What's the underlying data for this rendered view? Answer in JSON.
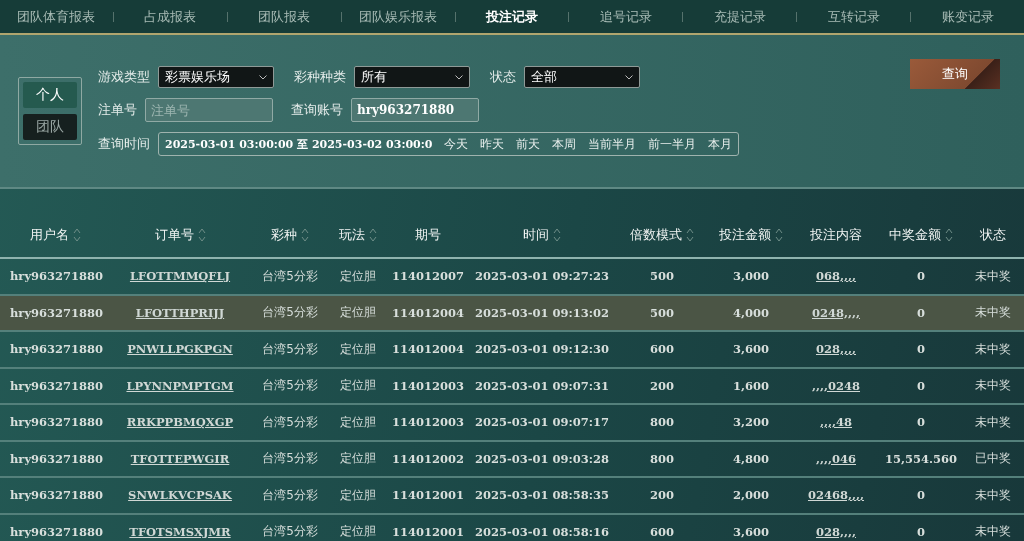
{
  "tabs": [
    {
      "label": "团队体育报表",
      "selected": false
    },
    {
      "label": "占成报表",
      "selected": false
    },
    {
      "label": "团队报表",
      "selected": false
    },
    {
      "label": "团队娱乐报表",
      "selected": false
    },
    {
      "label": "投注记录",
      "selected": true
    },
    {
      "label": "追号记录",
      "selected": false
    },
    {
      "label": "充提记录",
      "selected": false
    },
    {
      "label": "互转记录",
      "selected": false
    },
    {
      "label": "账变记录",
      "selected": false
    }
  ],
  "scope": [
    {
      "label": "个人",
      "selected": true
    },
    {
      "label": "团队",
      "selected": false
    }
  ],
  "filters": {
    "game_type": {
      "label": "游戏类型",
      "value": "彩票娱乐场"
    },
    "lottery_type": {
      "label": "彩种种类",
      "value": "所有"
    },
    "status": {
      "label": "状态",
      "value": "全部"
    },
    "order_no": {
      "label": "注单号",
      "placeholder": "注单号"
    },
    "account": {
      "label": "查询账号",
      "value": "hry963271880"
    },
    "time": {
      "label": "查询时间",
      "value": "2025-03-01 03:00:00 至 2025-03-02 03:00:0",
      "shortcuts": [
        "今天",
        "昨天",
        "前天",
        "本周",
        "当前半月",
        "前一半月",
        "本月"
      ]
    }
  },
  "query_button": "查询",
  "table": {
    "columns": [
      {
        "label": "用户名",
        "sortable": true
      },
      {
        "label": "订单号",
        "sortable": true
      },
      {
        "label": "彩种",
        "sortable": true
      },
      {
        "label": "玩法",
        "sortable": true
      },
      {
        "label": "期号",
        "sortable": false
      },
      {
        "label": "时间",
        "sortable": true
      },
      {
        "label": "倍数模式",
        "sortable": true
      },
      {
        "label": "投注金额",
        "sortable": true
      },
      {
        "label": "投注内容",
        "sortable": false
      },
      {
        "label": "中奖金额",
        "sortable": true
      },
      {
        "label": "状态",
        "sortable": false
      }
    ],
    "rows": [
      {
        "highlighted": false,
        "cells": [
          "hry963271880",
          "LFOTTMMQFLJ",
          "台湾5分彩",
          "定位胆",
          "114012007",
          "2025-03-01 09:27:23",
          "500",
          "3,000",
          "068,,,,",
          "0",
          "未中奖"
        ]
      },
      {
        "highlighted": true,
        "cells": [
          "hry963271880",
          "LFOTTHPRIJJ",
          "台湾5分彩",
          "定位胆",
          "114012004",
          "2025-03-01 09:13:02",
          "500",
          "4,000",
          "0248,,,,",
          "0",
          "未中奖"
        ]
      },
      {
        "highlighted": false,
        "cells": [
          "hry963271880",
          "PNWLLPGKPGN",
          "台湾5分彩",
          "定位胆",
          "114012004",
          "2025-03-01 09:12:30",
          "600",
          "3,600",
          "028,,,,",
          "0",
          "未中奖"
        ]
      },
      {
        "highlighted": false,
        "cells": [
          "hry963271880",
          "LPYNNPMPTGM",
          "台湾5分彩",
          "定位胆",
          "114012003",
          "2025-03-01 09:07:31",
          "200",
          "1,600",
          ",,,,0248",
          "0",
          "未中奖"
        ]
      },
      {
        "highlighted": false,
        "cells": [
          "hry963271880",
          "RRKPPBMQXGP",
          "台湾5分彩",
          "定位胆",
          "114012003",
          "2025-03-01 09:07:17",
          "800",
          "3,200",
          ",,,,48",
          "0",
          "未中奖"
        ]
      },
      {
        "highlighted": false,
        "cells": [
          "hry963271880",
          "TFOTTEPWGIR",
          "台湾5分彩",
          "定位胆",
          "114012002",
          "2025-03-01 09:03:28",
          "800",
          "4,800",
          ",,,,046",
          "15,554.560",
          "已中奖"
        ]
      },
      {
        "highlighted": false,
        "cells": [
          "hry963271880",
          "SNWLKVCPSAK",
          "台湾5分彩",
          "定位胆",
          "114012001",
          "2025-03-01 08:58:35",
          "200",
          "2,000",
          "02468,,,,",
          "0",
          "未中奖"
        ]
      },
      {
        "highlighted": false,
        "cells": [
          "hry963271880",
          "TFOTSMSXJMR",
          "台湾5分彩",
          "定位胆",
          "114012001",
          "2025-03-01 08:58:16",
          "600",
          "3,600",
          "028,,,,",
          "0",
          "未中奖"
        ]
      }
    ]
  }
}
